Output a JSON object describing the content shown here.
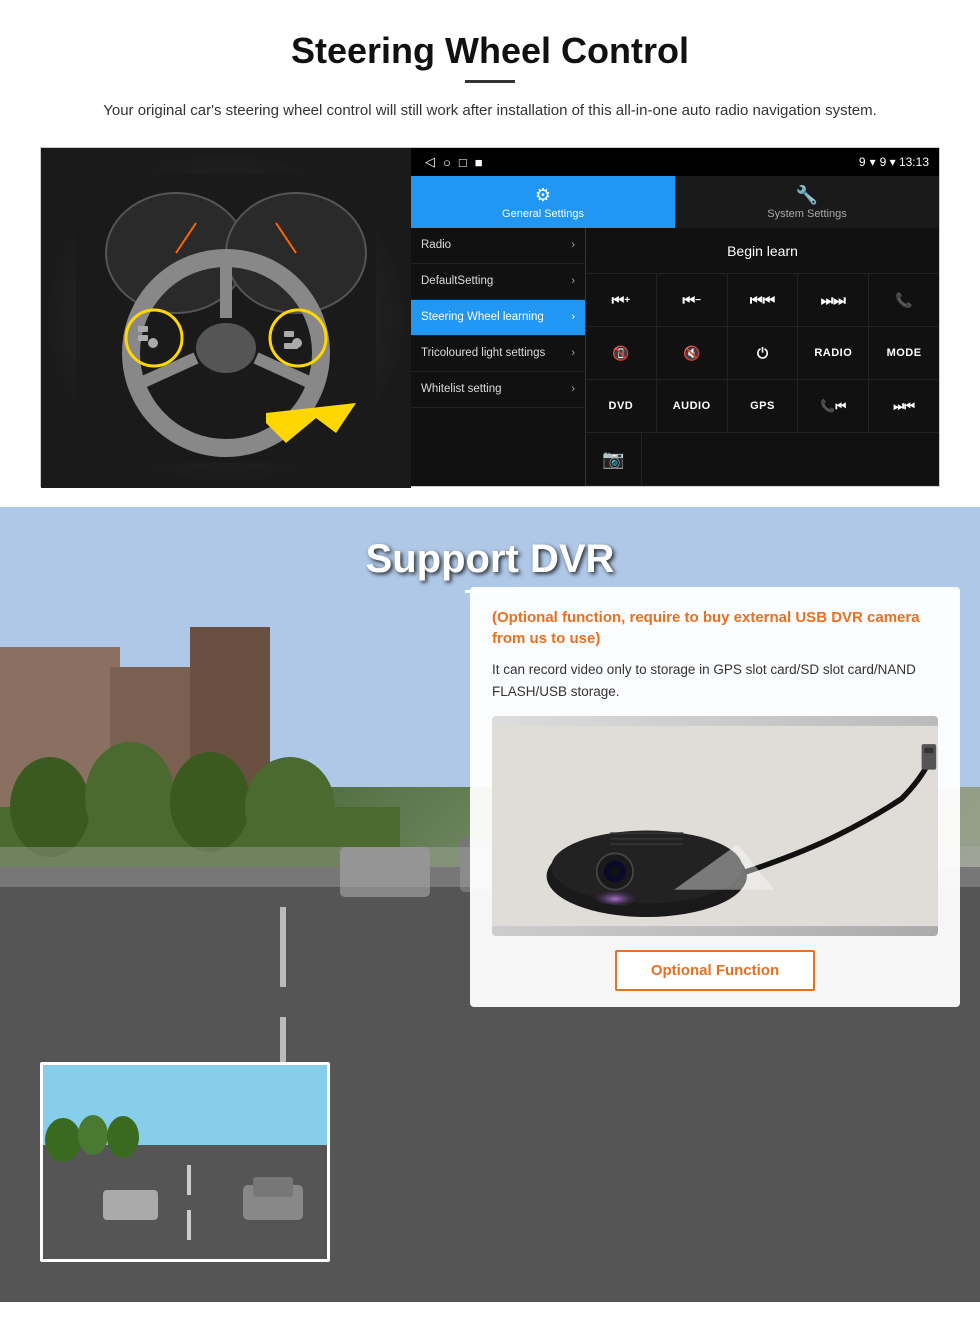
{
  "steering": {
    "title": "Steering Wheel Control",
    "subtitle": "Your original car's steering wheel control will still work after installation of this all-in-one auto radio navigation system.",
    "divider": "—",
    "statusbar": {
      "left_icons": [
        "◁",
        "○",
        "□",
        "■"
      ],
      "right_text": "9 ▾ 13:13"
    },
    "tabs": {
      "general": {
        "icon": "⚙",
        "label": "General Settings"
      },
      "system": {
        "icon": "🔧",
        "label": "System Settings"
      }
    },
    "menu": [
      {
        "label": "Radio",
        "active": false
      },
      {
        "label": "DefaultSetting",
        "active": false
      },
      {
        "label": "Steering Wheel learning",
        "active": true
      },
      {
        "label": "Tricoloured light settings",
        "active": false
      },
      {
        "label": "Whitelist setting",
        "active": false
      }
    ],
    "begin_learn": "Begin learn",
    "control_rows": [
      [
        "⏮+",
        "⏮−",
        "⏮⏮",
        "⏭⏭",
        "📞"
      ],
      [
        "📵",
        "🔇",
        "⏻",
        "RADIO",
        "MODE"
      ],
      [
        "DVD",
        "AUDIO",
        "GPS",
        "📞⏮⏭",
        "⏭⏮"
      ]
    ],
    "last_btn": "📷"
  },
  "dvr": {
    "title": "Support DVR",
    "optional_title": "(Optional function, require to buy external USB DVR camera from us to use)",
    "description": "It can record video only to storage in GPS slot card/SD slot card/NAND FLASH/USB storage.",
    "optional_btn_label": "Optional Function"
  }
}
